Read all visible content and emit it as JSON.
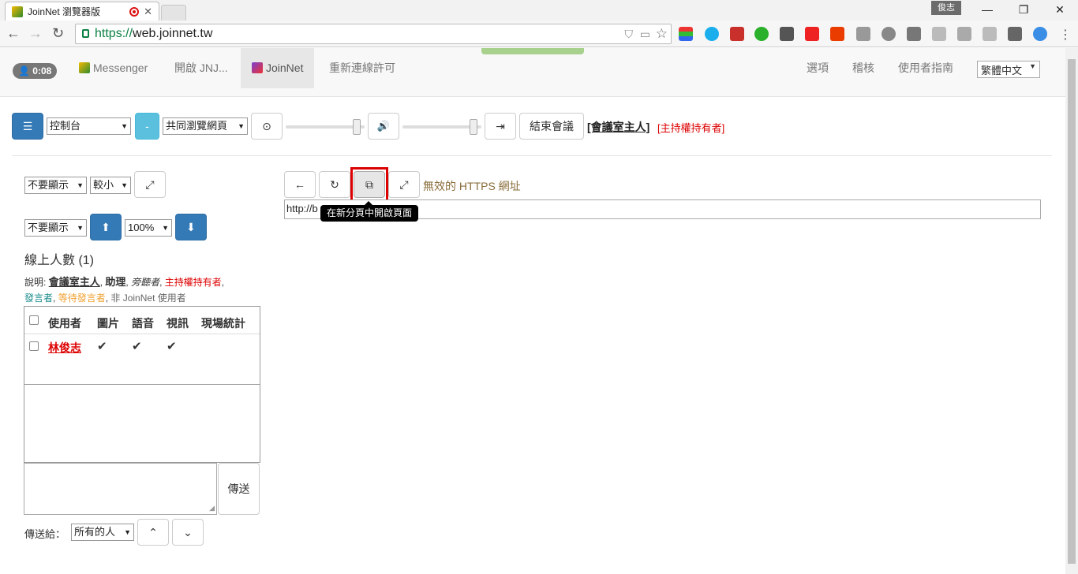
{
  "browser": {
    "tab_title": "JoinNet 瀏覽器版",
    "user_badge": "俊志",
    "url_scheme": "https://",
    "url_host": "web.joinnet.tw"
  },
  "nav": {
    "timer": "0:08",
    "items": [
      {
        "label": "Messenger"
      },
      {
        "label": "開啟 JNJ..."
      },
      {
        "label": "JoinNet"
      },
      {
        "label": "重新連線許可"
      }
    ],
    "right": [
      {
        "label": "選項"
      },
      {
        "label": "稽核"
      },
      {
        "label": "使用者指南"
      }
    ],
    "language": "繁體中文"
  },
  "toolbar": {
    "console_select": "控制台",
    "minus_label": "-",
    "cobrowse_select": "共同瀏覽網頁",
    "volume1": 0.9,
    "volume2": 0.9,
    "end_meeting": "結束會議",
    "role_host": "[會議室主人]",
    "role_moderator": "[主持權持有者]"
  },
  "left_panel": {
    "display1": "不要顯示",
    "size": "較小",
    "display2": "不要顯示",
    "zoom": "100%",
    "online_title": "線上人數 (1)",
    "legend_prefix": "說明:",
    "legend_host": "會議室主人",
    "legend_assistant": "助理",
    "legend_observer": "旁聽者",
    "legend_moderator": "主持權持有者",
    "legend_speaker": "發言者",
    "legend_waiting": "等待發言者",
    "legend_non_user": "非 JoinNet 使用者",
    "columns": [
      "使用者",
      "圖片",
      "語音",
      "視訊",
      "現場統計"
    ],
    "rows": [
      {
        "user": "林俊志",
        "picture": "✔",
        "voice": "✔",
        "video": "✔"
      }
    ],
    "send_button": "傳送",
    "send_to_label": "傳送給：",
    "send_to_value": "所有的人"
  },
  "browser_panel": {
    "invalid_https": "無效的 HTTPS 網址",
    "url_input": "http://b",
    "tooltip": "在新分頁中開啟頁面"
  }
}
